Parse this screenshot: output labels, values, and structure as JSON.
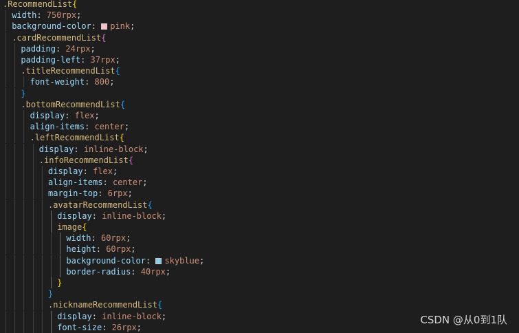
{
  "editor": {
    "lines": [
      {
        "indent": 0,
        "tokens": [
          {
            "t": ".RecommendList",
            "c": "sel"
          },
          {
            "t": "{",
            "c": "b1"
          }
        ]
      },
      {
        "indent": 1,
        "tokens": [
          {
            "t": "width",
            "c": "prop"
          },
          {
            "t": ": ",
            "c": "punc"
          },
          {
            "t": "750rpx",
            "c": "val"
          },
          {
            "t": ";",
            "c": "punc"
          }
        ]
      },
      {
        "indent": 1,
        "tokens": [
          {
            "t": "background-color",
            "c": "prop"
          },
          {
            "t": ": ",
            "c": "punc"
          },
          {
            "swatch": "#ffc0cb"
          },
          {
            "t": "pink",
            "c": "val"
          },
          {
            "t": ";",
            "c": "punc"
          }
        ]
      },
      {
        "indent": 1,
        "tokens": [
          {
            "t": ".cardRecommendList",
            "c": "sel"
          },
          {
            "t": "{",
            "c": "b2"
          }
        ]
      },
      {
        "indent": 2,
        "tokens": [
          {
            "t": "padding",
            "c": "prop"
          },
          {
            "t": ": ",
            "c": "punc"
          },
          {
            "t": "24rpx",
            "c": "val"
          },
          {
            "t": ";",
            "c": "punc"
          }
        ]
      },
      {
        "indent": 2,
        "tokens": [
          {
            "t": "padding-left",
            "c": "prop"
          },
          {
            "t": ": ",
            "c": "punc"
          },
          {
            "t": "37rpx",
            "c": "val"
          },
          {
            "t": ";",
            "c": "punc"
          }
        ]
      },
      {
        "indent": 2,
        "tokens": [
          {
            "t": ".titleRecommendList",
            "c": "sel"
          },
          {
            "t": "{",
            "c": "b3"
          }
        ]
      },
      {
        "indent": 3,
        "tokens": [
          {
            "t": "font-weight",
            "c": "prop"
          },
          {
            "t": ": ",
            "c": "punc"
          },
          {
            "t": "800",
            "c": "val"
          },
          {
            "t": ";",
            "c": "punc"
          }
        ]
      },
      {
        "indent": 2,
        "tokens": [
          {
            "t": "}",
            "c": "b3"
          }
        ]
      },
      {
        "indent": 2,
        "tokens": [
          {
            "t": ".bottomRecommendList",
            "c": "sel"
          },
          {
            "t": "{",
            "c": "b3"
          }
        ]
      },
      {
        "indent": 3,
        "tokens": [
          {
            "t": "display",
            "c": "prop"
          },
          {
            "t": ": ",
            "c": "punc"
          },
          {
            "t": "flex",
            "c": "val"
          },
          {
            "t": ";",
            "c": "punc"
          }
        ]
      },
      {
        "indent": 3,
        "tokens": [
          {
            "t": "align-items",
            "c": "prop"
          },
          {
            "t": ": ",
            "c": "punc"
          },
          {
            "t": "center",
            "c": "val"
          },
          {
            "t": ";",
            "c": "punc"
          }
        ]
      },
      {
        "indent": 3,
        "tokens": [
          {
            "t": ".leftRecommendList",
            "c": "sel"
          },
          {
            "t": "{",
            "c": "b1"
          }
        ]
      },
      {
        "indent": 4,
        "tokens": [
          {
            "t": "display",
            "c": "prop"
          },
          {
            "t": ": ",
            "c": "punc"
          },
          {
            "t": "inline-block",
            "c": "val"
          },
          {
            "t": ";",
            "c": "punc"
          }
        ]
      },
      {
        "indent": 4,
        "tokens": [
          {
            "t": ".infoRecommendList",
            "c": "sel"
          },
          {
            "t": "{",
            "c": "b2"
          }
        ]
      },
      {
        "indent": 5,
        "tokens": [
          {
            "t": "display",
            "c": "prop"
          },
          {
            "t": ": ",
            "c": "punc"
          },
          {
            "t": "flex",
            "c": "val"
          },
          {
            "t": ";",
            "c": "punc"
          }
        ]
      },
      {
        "indent": 5,
        "tokens": [
          {
            "t": "align-items",
            "c": "prop"
          },
          {
            "t": ": ",
            "c": "punc"
          },
          {
            "t": "center",
            "c": "val"
          },
          {
            "t": ";",
            "c": "punc"
          }
        ]
      },
      {
        "indent": 5,
        "tokens": [
          {
            "t": "margin-top",
            "c": "prop"
          },
          {
            "t": ": ",
            "c": "punc"
          },
          {
            "t": "6rpx",
            "c": "val"
          },
          {
            "t": ";",
            "c": "punc"
          }
        ]
      },
      {
        "indent": 5,
        "tokens": [
          {
            "t": ".avatarRecommendList",
            "c": "sel"
          },
          {
            "t": "{",
            "c": "b3"
          }
        ]
      },
      {
        "indent": 6,
        "tokens": [
          {
            "t": "display",
            "c": "prop"
          },
          {
            "t": ": ",
            "c": "punc"
          },
          {
            "t": "inline-block",
            "c": "val"
          },
          {
            "t": ";",
            "c": "punc"
          }
        ]
      },
      {
        "indent": 6,
        "tokens": [
          {
            "t": "image",
            "c": "sel"
          },
          {
            "t": "{",
            "c": "b1"
          }
        ]
      },
      {
        "indent": 7,
        "tokens": [
          {
            "t": "width",
            "c": "prop"
          },
          {
            "t": ": ",
            "c": "punc"
          },
          {
            "t": "60rpx",
            "c": "val"
          },
          {
            "t": ";",
            "c": "punc"
          }
        ]
      },
      {
        "indent": 7,
        "tokens": [
          {
            "t": "height",
            "c": "prop"
          },
          {
            "t": ": ",
            "c": "punc"
          },
          {
            "t": "60rpx",
            "c": "val"
          },
          {
            "t": ";",
            "c": "punc"
          }
        ]
      },
      {
        "indent": 7,
        "tokens": [
          {
            "t": "background-color",
            "c": "prop"
          },
          {
            "t": ": ",
            "c": "punc"
          },
          {
            "swatch": "#87ceeb"
          },
          {
            "t": "skyblue",
            "c": "val"
          },
          {
            "t": ";",
            "c": "punc"
          }
        ]
      },
      {
        "indent": 7,
        "tokens": [
          {
            "t": "border-radius",
            "c": "prop"
          },
          {
            "t": ": ",
            "c": "punc"
          },
          {
            "t": "40rpx",
            "c": "val"
          },
          {
            "t": ";",
            "c": "punc"
          }
        ]
      },
      {
        "indent": 6,
        "tokens": [
          {
            "t": "}",
            "c": "b1"
          }
        ]
      },
      {
        "indent": 5,
        "tokens": [
          {
            "t": "}",
            "c": "b3"
          }
        ]
      },
      {
        "indent": 5,
        "tokens": [
          {
            "t": ".nicknameRecommendList",
            "c": "sel"
          },
          {
            "t": "{",
            "c": "b3"
          }
        ]
      },
      {
        "indent": 6,
        "tokens": [
          {
            "t": "display",
            "c": "prop"
          },
          {
            "t": ": ",
            "c": "punc"
          },
          {
            "t": "inline-block",
            "c": "val"
          },
          {
            "t": ";",
            "c": "punc"
          }
        ]
      },
      {
        "indent": 6,
        "tokens": [
          {
            "t": "font-size",
            "c": "prop"
          },
          {
            "t": ": ",
            "c": "punc"
          },
          {
            "t": "26rpx",
            "c": "val"
          },
          {
            "t": ";",
            "c": "punc"
          }
        ]
      }
    ]
  },
  "watermark": "CSDN @从0到1队",
  "colors": {
    "background": "#1e1e1e",
    "selector": "#d7ba7d",
    "property": "#9cdcfe",
    "value": "#ce9178",
    "bracket_gold": "#ffd700",
    "bracket_orchid": "#da70d6",
    "bracket_blue": "#179fff"
  }
}
